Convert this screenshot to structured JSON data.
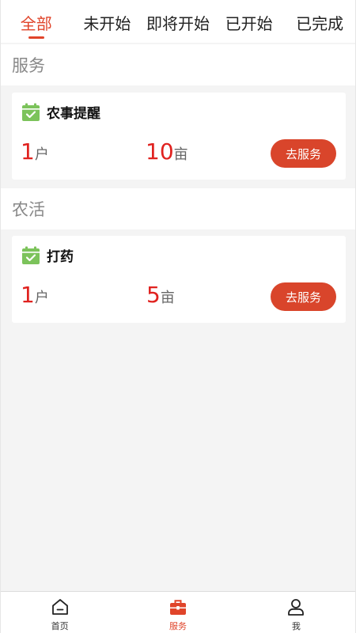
{
  "tabs": [
    {
      "label": "全部",
      "active": true
    },
    {
      "label": "未开始",
      "active": false
    },
    {
      "label": "即将开始",
      "active": false
    },
    {
      "label": "已开始",
      "active": false
    },
    {
      "label": "已完成",
      "active": false
    }
  ],
  "sections": [
    {
      "title": "服务",
      "card": {
        "icon": "calendar-check-icon",
        "title": "农事提醒",
        "households_value": "1",
        "households_unit": "户",
        "area_value": "10",
        "area_unit": "亩",
        "button_label": "去服务"
      }
    },
    {
      "title": "农活",
      "card": {
        "icon": "calendar-check-icon",
        "title": "打药",
        "households_value": "1",
        "households_unit": "户",
        "area_value": "5",
        "area_unit": "亩",
        "button_label": "去服务"
      }
    }
  ],
  "bottom_nav": [
    {
      "label": "首页",
      "icon": "home-icon",
      "active": false
    },
    {
      "label": "服务",
      "icon": "toolbox-icon",
      "active": true
    },
    {
      "label": "我",
      "icon": "user-icon",
      "active": false
    }
  ],
  "colors": {
    "accent": "#e0442a",
    "number_red": "#e0221f",
    "button": "#d9452b",
    "calendar_green": "#7cc35b"
  }
}
